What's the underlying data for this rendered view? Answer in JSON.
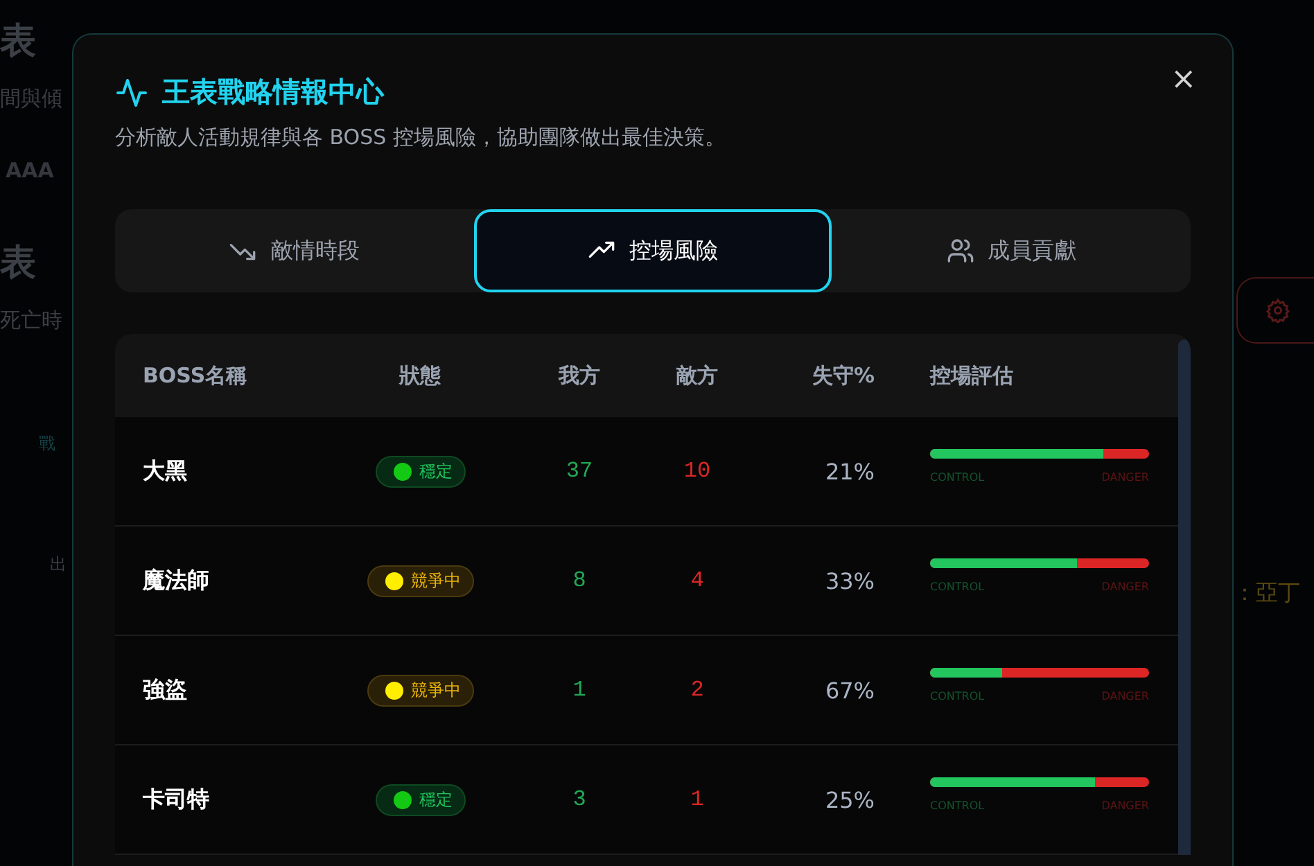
{
  "background": {
    "left_texts": [
      {
        "kind": "heading",
        "text": "表"
      },
      {
        "kind": "sub",
        "text": "間與傾"
      },
      {
        "kind": "tag",
        "text": "AAA"
      },
      {
        "kind": "heading",
        "text": "表"
      },
      {
        "kind": "sub",
        "text": "死亡時"
      },
      {
        "kind": "link",
        "text": "戰"
      },
      {
        "kind": "small",
        "text": "出"
      }
    ],
    "right_text": "：亞丁"
  },
  "dialog": {
    "title": "王表戰略情報中心",
    "subtitle": "分析敵人活動規律與各 BOSS 控場風險，協助團隊做出最佳決策。",
    "close": "×"
  },
  "tabs": [
    {
      "label": "敵情時段",
      "kind": "trend-down",
      "selected": false
    },
    {
      "label": "控場風險",
      "kind": "trend-up",
      "selected": true
    },
    {
      "label": "成員貢獻",
      "kind": "users",
      "selected": false
    }
  ],
  "table": {
    "columns": [
      "BOSS名稱",
      "狀態",
      "我方",
      "敵方",
      "失守%",
      "控場評估"
    ],
    "rows": [
      {
        "name": "大黑",
        "status": "穩定",
        "kind": "stable",
        "ours": "37",
        "enemy": "10",
        "loss": "21%",
        "level": 0.79,
        "control_label": "CONTROL",
        "danger_label": "DANGER"
      },
      {
        "name": "魔法師",
        "status": "競爭中",
        "kind": "contested",
        "ours": "8",
        "enemy": "4",
        "loss": "33%",
        "level": 0.67,
        "control_label": "CONTROL",
        "danger_label": "DANGER"
      },
      {
        "name": "強盜",
        "status": "競爭中",
        "kind": "contested",
        "ours": "1",
        "enemy": "2",
        "loss": "67%",
        "level": 0.33,
        "control_label": "CONTROL",
        "danger_label": "DANGER"
      },
      {
        "name": "卡司特",
        "status": "穩定",
        "kind": "stable",
        "ours": "3",
        "enemy": "1",
        "loss": "25%",
        "level": 0.75,
        "control_label": "CONTROL",
        "danger_label": "DANGER"
      }
    ]
  }
}
